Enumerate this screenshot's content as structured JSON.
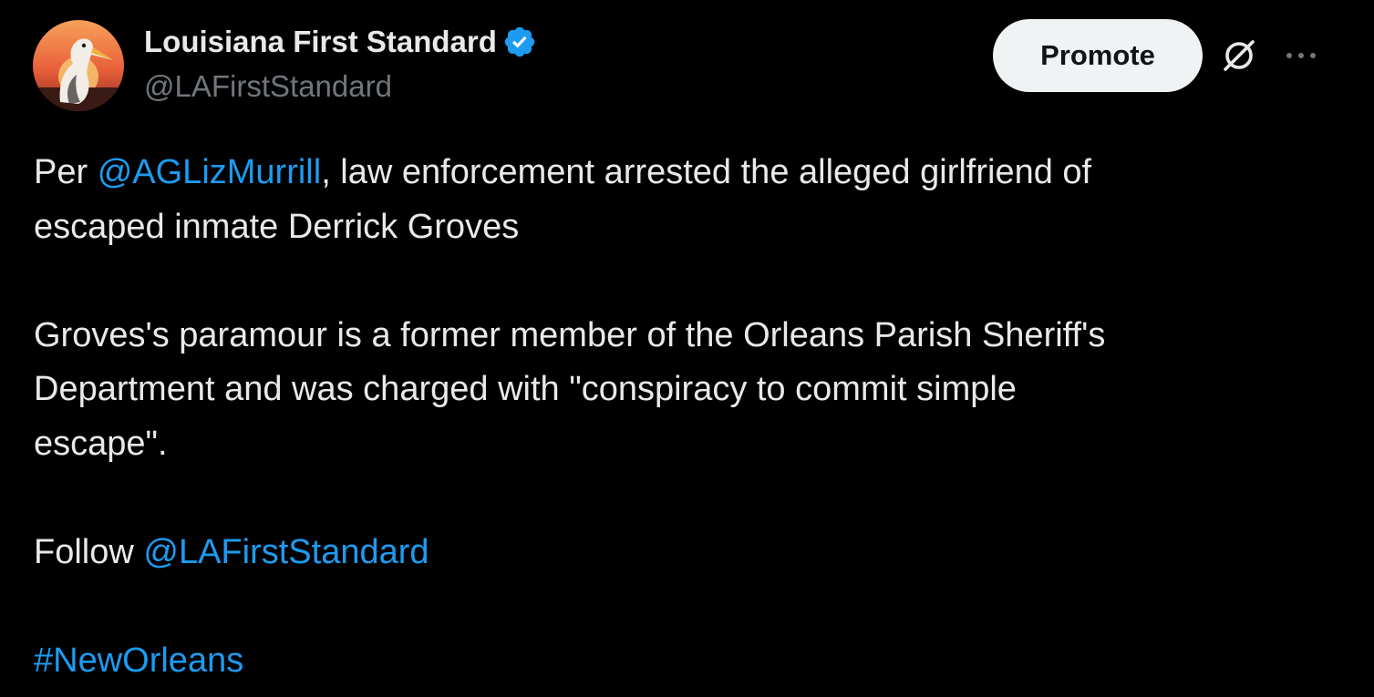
{
  "author": {
    "display_name": "Louisiana First Standard",
    "handle": "@LAFirstStandard",
    "verified": true
  },
  "actions": {
    "promote_label": "Promote",
    "grok_icon": "grok-slash-icon",
    "more_icon": "more-horizontal-icon"
  },
  "tweet": {
    "p1_prefix": "Per ",
    "p1_mention": "@AGLizMurrill",
    "p1_rest_line1": ", law enforcement arrested the alleged girlfriend of",
    "p1_line2": "escaped inmate Derrick Groves",
    "p2_line1": "Groves's paramour is a former member of the Orleans Parish Sheriff's",
    "p2_line2": "Department and was charged with \"conspiracy to commit simple",
    "p2_line3": "escape\".",
    "p3_prefix": "Follow ",
    "p3_mention": "@LAFirstStandard",
    "hashtag": "#NewOrleans"
  },
  "colors": {
    "background": "#000000",
    "text": "#e7e9ea",
    "secondary": "#71767b",
    "link": "#1d9bf0",
    "verified": "#1d9bf0",
    "button_bg": "#eff3f4"
  }
}
